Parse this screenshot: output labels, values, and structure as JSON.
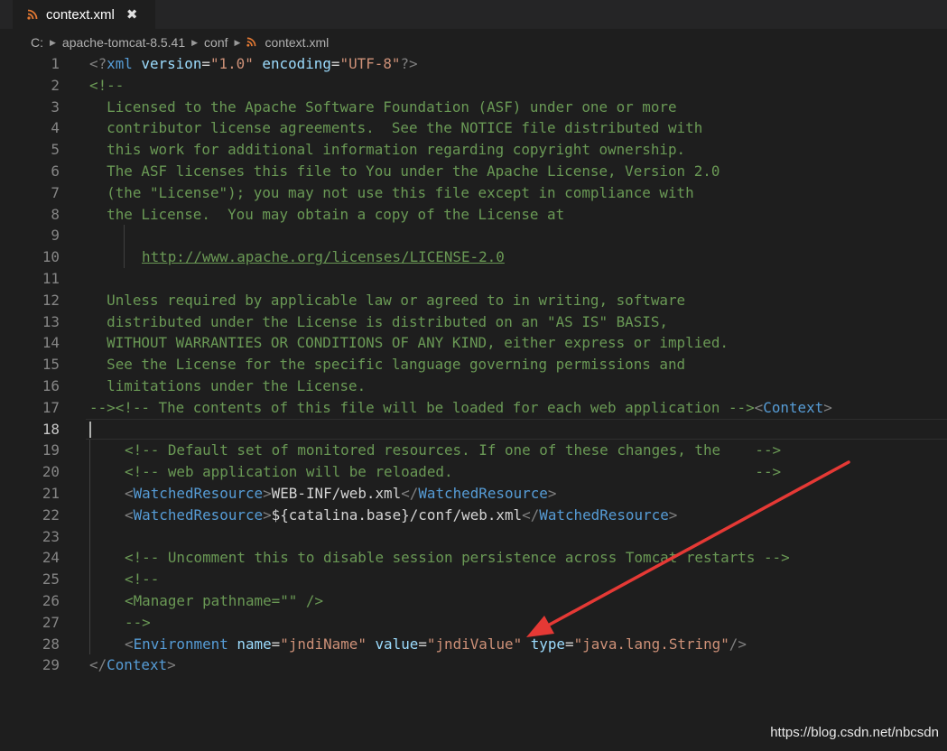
{
  "tab": {
    "title": "context.xml",
    "close_glyph": "✖",
    "icon": "rss-icon"
  },
  "breadcrumb": {
    "items": [
      "C:",
      "apache-tomcat-8.5.41",
      "conf",
      "context.xml"
    ],
    "separator_icon": "chevron-right-icon",
    "file_icon": "rss-icon"
  },
  "colors": {
    "tag": "#569cd6",
    "attr": "#9cdcfe",
    "string": "#ce9178",
    "comment": "#6a9955",
    "punct": "#808080",
    "text": "#d4d4d4",
    "arrow": "#e53935"
  },
  "editor": {
    "current_line": 18,
    "lines": [
      {
        "n": "1"
      },
      {
        "n": "2"
      },
      {
        "n": "3"
      },
      {
        "n": "4"
      },
      {
        "n": "5"
      },
      {
        "n": "6"
      },
      {
        "n": "7"
      },
      {
        "n": "8"
      },
      {
        "n": "9"
      },
      {
        "n": "10"
      },
      {
        "n": "11"
      },
      {
        "n": "12"
      },
      {
        "n": "13"
      },
      {
        "n": "14"
      },
      {
        "n": "15"
      },
      {
        "n": "16"
      },
      {
        "n": "17"
      },
      {
        "n": "18"
      },
      {
        "n": "19"
      },
      {
        "n": "20"
      },
      {
        "n": "21"
      },
      {
        "n": "22"
      },
      {
        "n": "23"
      },
      {
        "n": "24"
      },
      {
        "n": "25"
      },
      {
        "n": "26"
      },
      {
        "n": "27"
      },
      {
        "n": "28"
      },
      {
        "n": "29"
      }
    ],
    "code": {
      "l1": {
        "open": "<?",
        "tag": "xml",
        "a1": " version",
        "eq1": "=",
        "v1": "\"1.0\"",
        "a2": " encoding",
        "eq2": "=",
        "v2": "\"UTF-8\"",
        "close": "?>"
      },
      "l2": "<!--",
      "l3": "  Licensed to the Apache Software Foundation (ASF) under one or more",
      "l4": "  contributor license agreements.  See the NOTICE file distributed with",
      "l5": "  this work for additional information regarding copyright ownership.",
      "l6": "  The ASF licenses this file to You under the Apache License, Version 2.0",
      "l7": "  (the \"License\"); you may not use this file except in compliance with",
      "l8": "  the License.  You may obtain a copy of the License at",
      "l10": "http://www.apache.org/licenses/LICENSE-2.0",
      "l12": "  Unless required by applicable law or agreed to in writing, software",
      "l13": "  distributed under the License is distributed on an \"AS IS\" BASIS,",
      "l14": "  WITHOUT WARRANTIES OR CONDITIONS OF ANY KIND, either express or implied.",
      "l15": "  See the License for the specific language governing permissions and",
      "l16": "  limitations under the License.",
      "l17": {
        "c1": "--><!-- The contents of this file will be loaded for each web application -->",
        "lt": "<",
        "tag": "Context",
        "gt": ">"
      },
      "l19": "<!-- Default set of monitored resources. If one of these changes, the    -->",
      "l20": "<!-- web application will be reloaded.                                   -->",
      "l21": {
        "lt1": "<",
        "tag1": "WatchedResource",
        "gt1": ">",
        "text": "WEB-INF/web.xml",
        "lt2": "</",
        "tag2": "WatchedResource",
        "gt2": ">"
      },
      "l22": {
        "lt1": "<",
        "tag1": "WatchedResource",
        "gt1": ">",
        "text": "${catalina.base}/conf/web.xml",
        "lt2": "</",
        "tag2": "WatchedResource",
        "gt2": ">"
      },
      "l24": "<!-- Uncomment this to disable session persistence across Tomcat restarts -->",
      "l25": "<!--",
      "l26": "<Manager pathname=\"\" />",
      "l27": "-->",
      "l28": {
        "lt": "<",
        "tag": "Environment",
        "a1": " name",
        "eq1": "=",
        "v1": "\"jndiName\"",
        "a2": " value",
        "eq2": "=",
        "v2": "\"jndiValue\"",
        "a3": " type",
        "eq3": "=",
        "v3": "\"java.lang.String\"",
        "close": "/>"
      },
      "l29": {
        "lt": "</",
        "tag": "Context",
        "gt": ">"
      }
    }
  },
  "annotation": {
    "type": "arrow",
    "pointing_to": "value attribute on line 28"
  },
  "watermark": "https://blog.csdn.net/nbcsdn"
}
